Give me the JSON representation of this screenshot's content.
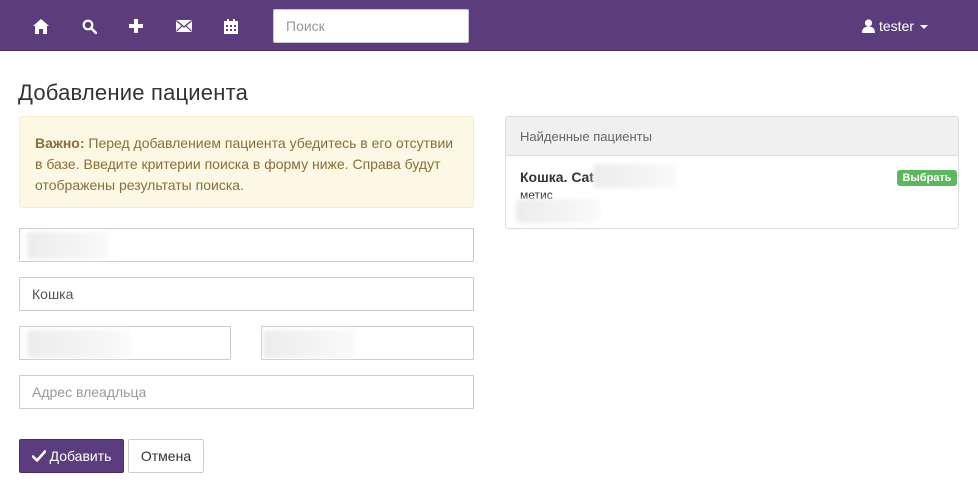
{
  "navbar": {
    "icons": [
      "home-icon",
      "search-icon",
      "plus-icon",
      "envelope-icon",
      "calendar-icon"
    ],
    "search_placeholder": "Поиск",
    "user_name": "tester",
    "bg_color": "#5b3d7e"
  },
  "page": {
    "title": "Добавление пациента"
  },
  "alert": {
    "strong": "Важно:",
    "text": " Перед добавлением пациента убедитесь в его отсутвии в базе. Введите критерии поиска в форму ниже. Справа будут отображены результаты поиска."
  },
  "form": {
    "field1_value": "",
    "species_value": "Кошка",
    "field3_value": "",
    "field4_value": "",
    "address_placeholder": "Адрес влеадльца",
    "submit_label": "Добавить",
    "cancel_label": "Отмена"
  },
  "results": {
    "heading": "Найденные пациенты",
    "items": [
      {
        "name": "Кошка. Cat",
        "breed": "метис",
        "select_label": "Выбрать"
      }
    ]
  }
}
